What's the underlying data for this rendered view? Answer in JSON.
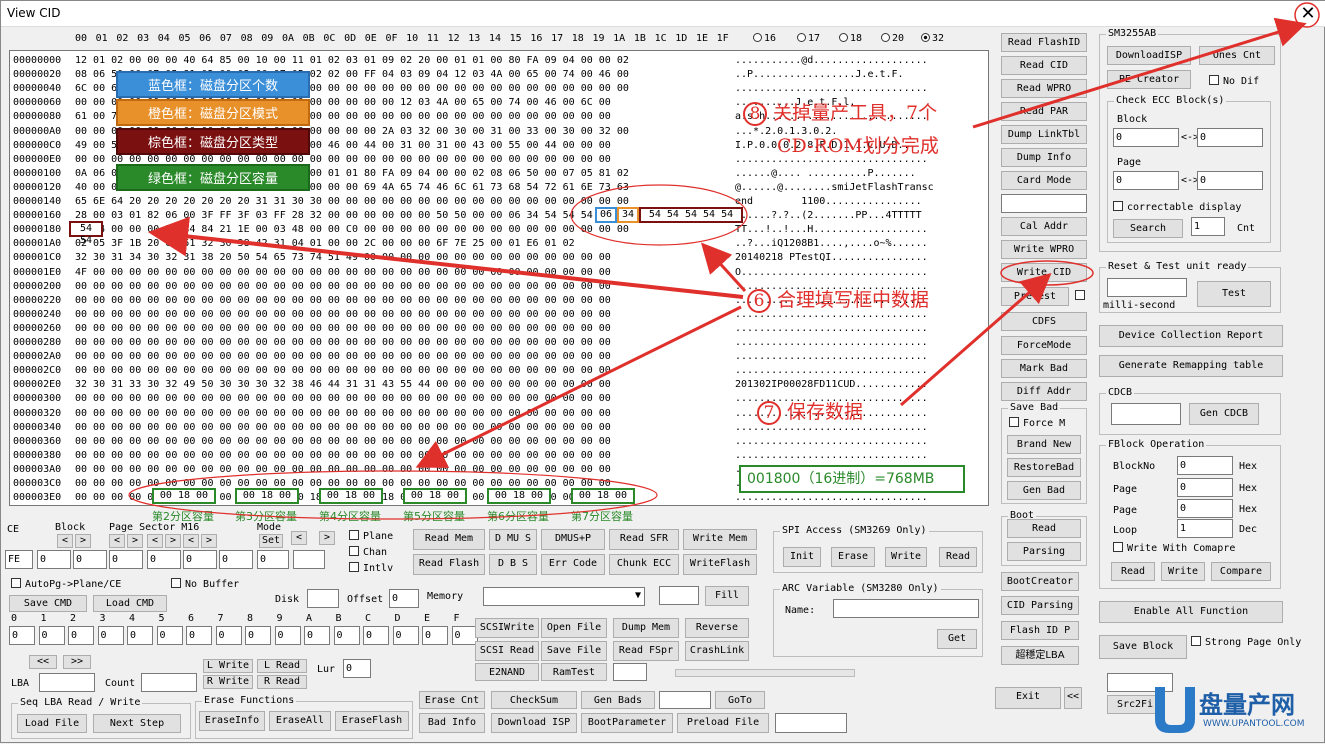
{
  "window": {
    "title": "View CID",
    "close_icon": "close-icon"
  },
  "hex_header": {
    "cols": [
      "00",
      "01",
      "02",
      "03",
      "04",
      "05",
      "06",
      "07",
      "08",
      "09",
      "0A",
      "0B",
      "0C",
      "0D",
      "0E",
      "0F",
      "10",
      "11",
      "12",
      "13",
      "14",
      "15",
      "16",
      "17",
      "18",
      "19",
      "1A",
      "1B",
      "1C",
      "1D",
      "1E",
      "1F"
    ],
    "radios": [
      {
        "label": "16",
        "on": false
      },
      {
        "label": "17",
        "on": false
      },
      {
        "label": "18",
        "on": false
      },
      {
        "label": "20",
        "on": false
      },
      {
        "label": "32",
        "on": true
      }
    ]
  },
  "hex_rows": [
    {
      "addr": "00000000",
      "hex": "12 01 02 00 00 00 40 64 85 00 10 00 11 01 02 03 01 09 02 20 00 01 01 00 80 FA 09 04 00 00 02",
      "ascii": "...........@d..................."
    },
    {
      "addr": "00000020",
      "hex": "08 06 50 00 07 05 81 02 00 02 00 07 05 02 02 00 FF 04 03 09 04 12 03 4A 00 65 00 74 00 46 00",
      "ascii": "..P.................J.e.t.F."
    },
    {
      "addr": "00000040",
      "hex": "6C 00 61 00 73 00 68 00 00 00 00 00 00 00 00 00 00 00 00 00 00 00 00 00 00 00 00 00 00 00 00",
      "ascii": "................................"
    },
    {
      "addr": "00000060",
      "hex": "00 00 00 00 00 00 00 00 00 00 00 00 00 00 00 00 00 00 12 03 4A 00 65 00 74 00 46 00 6C 00",
      "ascii": "..........J.e.t.F.l."
    },
    {
      "addr": "00000080",
      "hex": "61 00 73 00 68 00 00 00 00 00 00 00 00 00 00 00 00 00 00 00 00 00 00 00 00 00 00 00 00 00",
      "ascii": "a.s.h..........................."
    },
    {
      "addr": "000000A0",
      "hex": "00 00 00 00 00 00 00 00 00 00 00 00 00 00 00 00 00 2A 03 32 00 30 00 31 00 33 00 30 00 32 00",
      "ascii": "...*.2.0.1.3.0.2."
    },
    {
      "addr": "000000C0",
      "hex": "49 00 50 00 30 00 30 00 30 00 32 00 38 00 46 00 44 00 31 00 31 00 43 00 55 00 44 00 00 00",
      "ascii": "I.P.0.0.0.2.8.F.D.1.1.C.U.D..."
    },
    {
      "addr": "000000E0",
      "hex": "00 00 00 00 00 00 00 00 00 00 00 00 00 00 00 00 00 00 00 00 00 00 00 00 00 00 00 00 00 00",
      "ascii": "................................"
    },
    {
      "addr": "00000100",
      "hex": "0A 06 00 02 00 00 00 40 01 00 09 02 20 00 01 01 80 FA 09 04 00 00 02 08 06 50 00 07 05 81 02",
      "ascii": "......@.... ..........P......."
    },
    {
      "addr": "00000120",
      "hex": "40 00 00 07 05 02 02 40 00 00 00 00 00 00 00 00 69 4A 65 74 46 6C 61 73 68 54 72 61 6E 73 63",
      "ascii": "@......@........smiJetFlashTransc"
    },
    {
      "addr": "00000140",
      "hex": "65 6E 64 20 20 20 20 20 20 20 31 31 30 30 00 00 00 00 00 00 00 00 00 00 00 00 00 00 00 00 00",
      "ascii": "end        1100................"
    },
    {
      "addr": "00000160",
      "hex": "28 00 03 01 82 06 00 3F FF 3F 03 FF 28 32 00 00 00 00 00 00 50 50 00 00 06 34 54 54 54 54 54",
      "ascii": "(.....?.?..(2.......PP...4TTTTT"
    },
    {
      "addr": "00000180",
      "hex": "54 54 00 00 00 21 84 84 21 1E 00 03 48 00 00 C0 00 00 00 00 00 00 00 00 00 00 00 00 00 00 00",
      "ascii": "TT...!..!...H..................."
    },
    {
      "addr": "000001A0",
      "hex": "02 05 3F 1B 20 69 51 32 30 38 42 31 04 01 00 00 2C 00 00 00 6F 7E 25 00 01 E6 01 02",
      "ascii": "..?...iQ1208B1....,....o~%......"
    },
    {
      "addr": "000001C0",
      "hex": "32 30 31 34 30 32 31 38 20 50 54 65 73 74 51 49 00 00 00 00 00 00 00 00 00 00 00 00 00 00",
      "ascii": "20140218 PTestQI................"
    },
    {
      "addr": "000001E0",
      "hex": "4F 00 00 00 00 00 00 00 00 00 00 00 00 00 00 00 00 00 00 00 00 00 00 00 00 00 00 00 00 00",
      "ascii": "O..............................."
    },
    {
      "addr": "00000200",
      "hex": "00 00 00 00 00 00 00 00 00 00 00 00 00 00 00 00 00 00 00 00 00 00 00 00 00 00 00 00 00 00",
      "ascii": "................................"
    },
    {
      "addr": "00000220",
      "hex": "00 00 00 00 00 00 00 00 00 00 00 00 00 00 00 00 00 00 00 00 00 00 00 00 00 00 00 00 00 00",
      "ascii": "................................"
    },
    {
      "addr": "00000240",
      "hex": "00 00 00 00 00 00 00 00 00 00 00 00 00 00 00 00 00 00 00 00 00 00 00 00 00 00 00 00 00 00",
      "ascii": "................................"
    },
    {
      "addr": "00000260",
      "hex": "00 00 00 00 00 00 00 00 00 00 00 00 00 00 00 00 00 00 00 00 00 00 00 00 00 00 00 00 00 00",
      "ascii": "................................"
    },
    {
      "addr": "00000280",
      "hex": "00 00 00 00 00 00 00 00 00 00 00 00 00 00 00 00 00 00 00 00 00 00 00 00 00 00 00 00 00 00",
      "ascii": "................................"
    },
    {
      "addr": "000002A0",
      "hex": "00 00 00 00 00 00 00 00 00 00 00 00 00 00 00 00 00 00 00 00 00 00 00 00 00 00 00 00 00 00",
      "ascii": "................................"
    },
    {
      "addr": "000002C0",
      "hex": "00 00 00 00 00 00 00 00 00 00 00 00 00 00 00 00 00 00 00 00 00 00 00 00 00 00 00 00 00 00",
      "ascii": "................................"
    },
    {
      "addr": "000002E0",
      "hex": "32 30 31 33 30 32 49 50 30 30 30 32 38 46 44 31 31 43 55 44 00 00 00 00 00 00 00 00 00 00",
      "ascii": "201302IP00028FD11CUD............"
    },
    {
      "addr": "00000300",
      "hex": "00 00 00 00 00 00 00 00 00 00 00 00 00 00 00 00 00 00 00 00 00 00 00 00 00 00 00 00 00 00",
      "ascii": "................................"
    },
    {
      "addr": "00000320",
      "hex": "00 00 00 00 00 00 00 00 00 00 00 00 00 00 00 00 00 00 00 00 00 00 00 00 00 00 00 00 00 00",
      "ascii": "................................"
    },
    {
      "addr": "00000340",
      "hex": "00 00 00 00 00 00 00 00 00 00 00 00 00 00 00 00 00 00 00 00 00 00 00 00 00 00 00 00 00 00",
      "ascii": "................................"
    },
    {
      "addr": "00000360",
      "hex": "00 00 00 00 00 00 00 00 00 00 00 00 00 00 00 00 00 00 00 00 00 00 00 00 00 00 00 00 00 00",
      "ascii": "................................"
    },
    {
      "addr": "00000380",
      "hex": "00 00 00 00 00 00 00 00 00 00 00 00 00 00 00 00 00 00 00 00 00 00 00 00 00 00 00 00 00 00",
      "ascii": "................................"
    },
    {
      "addr": "000003A0",
      "hex": "00 00 00 00 00 00 00 00 00 00 00 00 00 00 00 00 00 00 00 00 00 00 00 00 00 00 00 00 00 00",
      "ascii": "................................"
    },
    {
      "addr": "000003C0",
      "hex": "00 00 00 00 00 00 00 00 00 00 00 00 00 00 00 00 00 00 00 00 00 00 00 00 00 00 00 00 00 00",
      "ascii": "................................"
    },
    {
      "addr": "000003E0",
      "hex": "00 00 00 00 00 18 00 00 00 18 00 00 00 18 00 00 00 18 00 00 00 18 00 00 00 18 00 00 00 00",
      "ascii": "................................"
    }
  ],
  "annotations": {
    "blue": "蓝色框：磁盘分区个数",
    "orange": "橙色框：磁盘分区模式",
    "brown": "棕色框：磁盘分区类型",
    "green": "绿色框：磁盘分区容量",
    "step8_num": "8",
    "step8_line1": "关掉量产工具，7个",
    "step8_line2": "CD-ROM划分完成",
    "step6_num": "6",
    "step6": "合理填写框中数据",
    "step7_num": "7",
    "step7": "保存数据",
    "capacity_note": "001800（16进制）=768MB",
    "cell_54": "54 54",
    "cell_06": "06",
    "cell_34": "34",
    "cell_5454": "54 54 54 54 54",
    "cap_cells": [
      "00 18 00",
      "00 18 00",
      "00 18 00",
      "00 18 00",
      "00 18 00",
      "00 18 00"
    ],
    "cap_labels": [
      "第2分区容量",
      "第3分区容量",
      "第4分区容量",
      "第5分区容量",
      "第6分区容量",
      "第7分区容量"
    ],
    "colors": {
      "blue": "#3b8fd9",
      "orange": "#e8902a",
      "brown": "#7a1010",
      "green": "#2a8a2a",
      "red": "#e0302c"
    }
  },
  "right_col_buttons": [
    "Read FlashID",
    "Read CID",
    "Read WPRO",
    "Read PAR",
    "Dump LinkTbl",
    "Dump Info",
    "Card Mode",
    "Cal Addr",
    "Write WPRO",
    "Write CID",
    "Pretest",
    "CDFS",
    "ForceMode",
    "Mark Bad",
    "Diff Addr"
  ],
  "save_bad": {
    "title": "Save Bad",
    "force": "Force M",
    "brand_new": "Brand New",
    "restore": "RestoreBad",
    "gen": "Gen Bad"
  },
  "boot": {
    "title": "Boot",
    "read": "Read",
    "parsing": "Parsing"
  },
  "misc_right": {
    "boot_creator": "BootCreator",
    "cid_parsing": "CID Parsing",
    "flash_id": "Flash ID P",
    "super_lba": "超穩定LBA",
    "exit": "Exit",
    "collapse": "<<"
  },
  "sm3255": {
    "title": "SM3255AB",
    "download_isp": "DownloadISP",
    "ones_cnt": "Ones Cnt",
    "pe_creator": "PE Creator",
    "no_dif": "No Dif",
    "ecc": {
      "title": "Check ECC Block(s)",
      "block": "Block",
      "block_from": "0",
      "arrow1": "<->",
      "block_to": "0",
      "page": "Page",
      "page_from": "0",
      "arrow2": "<->",
      "page_to": "0",
      "correctable": "correctable display",
      "search": "Search",
      "cnt_val": "1",
      "cnt": "Cnt"
    }
  },
  "reset": {
    "title": "Reset & Test unit ready",
    "ms": "milli-second",
    "test": "Test"
  },
  "reports": {
    "device": "Device Collection Report",
    "remap": "Generate Remapping table"
  },
  "cdcb": {
    "title": "CDCB",
    "gen": "Gen CDCB"
  },
  "fblock": {
    "title": "FBlock Operation",
    "blockno": "BlockNo",
    "blockno_val": "0",
    "page1": "Page",
    "page1_val": "0",
    "page2": "Page",
    "page2_val": "0",
    "loop": "Loop",
    "loop_val": "1",
    "hex1": "Hex",
    "hex2": "Hex",
    "hex3": "Hex",
    "dec": "Dec",
    "wwc": "Write With Comapre",
    "read": "Read",
    "write": "Write",
    "compare": "Compare"
  },
  "enable_all": "Enable All Function",
  "save_block": "Save Block",
  "strong_page": "Strong Page Only",
  "src2fi": "Src2Fi",
  "bottom": {
    "ce": "CE",
    "block": "Block",
    "page_sector": "Page Sector M16",
    "mode": "Mode",
    "set": "Set",
    "fe": "FE",
    "f0": "0",
    "f1": "0",
    "f2": "0",
    "f3": "0",
    "f4": "0",
    "f5": "0",
    "f6": "0",
    "plane": "Plane",
    "chan": "Chan",
    "intlv": "Intlv",
    "read_mem": "Read Mem",
    "dmus": "D MU S",
    "dmusp": "DMUS+P",
    "read_sfr": "Read SFR",
    "write_mem": "Write Mem",
    "read_flash": "Read Flash",
    "dbs": "D B S",
    "err_code": "Err Code",
    "chunk_ecc": "Chunk ECC",
    "write_flash": "WriteFlash",
    "autopg": "AutoPg->Plane/CE",
    "no_buffer": "No Buffer",
    "save_cmd": "Save CMD",
    "load_cmd": "Load CMD",
    "disk": "Disk",
    "offset": "Offset",
    "offset_val": "0",
    "memory": "Memory",
    "fill": "Fill",
    "hexlabels": [
      "0",
      "1",
      "2",
      "3",
      "4",
      "5",
      "6",
      "7",
      "8",
      "9",
      "A",
      "B",
      "C",
      "D",
      "E",
      "F"
    ],
    "hexvals": [
      "0",
      "0",
      "0",
      "0",
      "0",
      "0",
      "0",
      "0",
      "0",
      "0",
      "0",
      "0",
      "0",
      "0",
      "0",
      "0"
    ],
    "scsi_write": "SCSIWrite",
    "open_file": "Open File",
    "dump_mem": "Dump Mem",
    "reverse": "Reverse",
    "scsi_read": "SCSI Read",
    "save_file": "Save File",
    "read_fspr": "Read FSpr",
    "crashlink": "CrashLink",
    "e2nand": "E2NAND",
    "ramtest": "RamTest",
    "prev": "<<",
    "next": ">>",
    "lur": "Lur",
    "lur_val": "0",
    "lwrite": "L Write",
    "lread": "L Read",
    "rwrite": "R Write",
    "rread": "R Read",
    "lba": "LBA",
    "count": "Count",
    "seq_title": "Seq LBA Read / Write",
    "load_file": "Load File",
    "next_step": "Next Step",
    "erase_title": "Erase Functions",
    "erase_info": "EraseInfo",
    "erase_all": "EraseAll",
    "erase_flash": "EraseFlash",
    "erase_cnt": "Erase Cnt",
    "checksum": "CheckSum",
    "gen_bads": "Gen Bads",
    "goto": "GoTo",
    "bad_info": "Bad Info",
    "download_isp": "Download ISP",
    "boot_param": "BootParameter",
    "preload": "Preload File"
  },
  "spi": {
    "title": "SPI Access (SM3269 Only)",
    "init": "Init",
    "erase": "Erase",
    "write": "Write",
    "read": "Read"
  },
  "arc": {
    "title": "ARC Variable (SM3280 Only)",
    "name": "Name:",
    "get": "Get"
  },
  "logo": {
    "text": "盘量产网",
    "url": "WWW.UPANTOOL.COM"
  }
}
